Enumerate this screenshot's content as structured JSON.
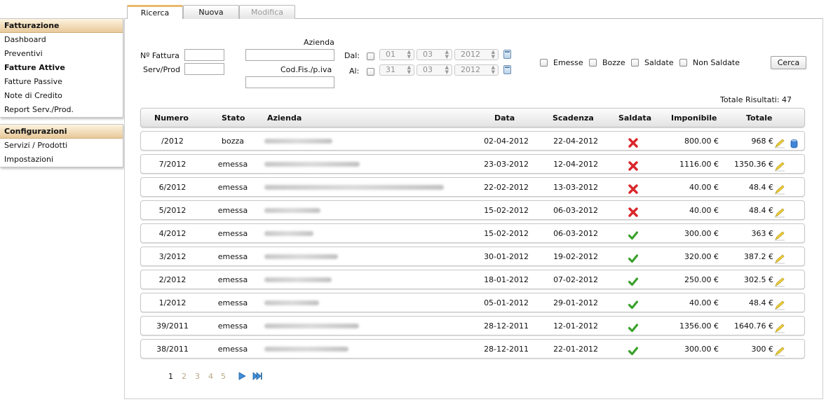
{
  "sidebar": {
    "groups": [
      {
        "title": "Fatturazione",
        "items": [
          "Dashboard",
          "Preventivi",
          "Fatture Attive",
          "Fatture Passive",
          "Note di Credito",
          "Report Serv./Prod."
        ]
      },
      {
        "title": "Configurazioni",
        "items": [
          "Servizi / Prodotti",
          "Impostazioni"
        ]
      }
    ],
    "active_item": "Fatture Attive"
  },
  "tabs": [
    {
      "label": "Ricerca",
      "state": "selected"
    },
    {
      "label": "Nuova",
      "state": "normal"
    },
    {
      "label": "Modifica",
      "state": "disabled"
    }
  ],
  "search": {
    "numero_label": "Nº Fattura",
    "numero_value": "",
    "servprod_label": "Serv/Prod",
    "servprod_value": "",
    "azienda_label": "Azienda",
    "azienda_value": "",
    "codfis_label": "Cod.Fis./p.iva",
    "codfis_value": "",
    "dal_label": "Dal:",
    "al_label": "Al:",
    "dal": {
      "day": "01",
      "month": "03",
      "year": "2012"
    },
    "al": {
      "day": "31",
      "month": "03",
      "year": "2012"
    },
    "filters": [
      "Emesse",
      "Bozze",
      "Saldate",
      "Non Saldate"
    ],
    "button": "Cerca"
  },
  "total_results": "Totale Risultati: 47",
  "table": {
    "headers": [
      "Numero",
      "Stato",
      "Azienda",
      "Data",
      "Scadenza",
      "Saldata",
      "Imponibile",
      "Totale"
    ],
    "rows": [
      {
        "numero": "/2012",
        "stato": "bozza",
        "data": "02-04-2012",
        "scadenza": "22-04-2012",
        "saldata": false,
        "imponibile": "800.00 €",
        "totale": "968 €",
        "deletable": true
      },
      {
        "numero": "7/2012",
        "stato": "emessa",
        "data": "23-03-2012",
        "scadenza": "12-04-2012",
        "saldata": false,
        "imponibile": "1116.00 €",
        "totale": "1350.36 €",
        "deletable": false
      },
      {
        "numero": "6/2012",
        "stato": "emessa",
        "data": "22-02-2012",
        "scadenza": "13-03-2012",
        "saldata": false,
        "imponibile": "40.00 €",
        "totale": "48.4 €",
        "deletable": false
      },
      {
        "numero": "5/2012",
        "stato": "emessa",
        "data": "15-02-2012",
        "scadenza": "06-03-2012",
        "saldata": false,
        "imponibile": "40.00 €",
        "totale": "48.4 €",
        "deletable": false
      },
      {
        "numero": "4/2012",
        "stato": "emessa",
        "data": "15-02-2012",
        "scadenza": "06-03-2012",
        "saldata": true,
        "imponibile": "300.00 €",
        "totale": "363 €",
        "deletable": false
      },
      {
        "numero": "3/2012",
        "stato": "emessa",
        "data": "30-01-2012",
        "scadenza": "19-02-2012",
        "saldata": true,
        "imponibile": "320.00 €",
        "totale": "387.2 €",
        "deletable": false
      },
      {
        "numero": "2/2012",
        "stato": "emessa",
        "data": "18-01-2012",
        "scadenza": "07-02-2012",
        "saldata": true,
        "imponibile": "250.00 €",
        "totale": "302.5 €",
        "deletable": false
      },
      {
        "numero": "1/2012",
        "stato": "emessa",
        "data": "05-01-2012",
        "scadenza": "29-01-2012",
        "saldata": true,
        "imponibile": "40.00 €",
        "totale": "48.4 €",
        "deletable": false
      },
      {
        "numero": "39/2011",
        "stato": "emessa",
        "data": "28-12-2011",
        "scadenza": "12-01-2012",
        "saldata": true,
        "imponibile": "1356.00 €",
        "totale": "1640.76 €",
        "deletable": false
      },
      {
        "numero": "38/2011",
        "stato": "emessa",
        "data": "28-12-2011",
        "scadenza": "22-01-2012",
        "saldata": true,
        "imponibile": "300.00 €",
        "totale": "300 €",
        "deletable": false
      }
    ]
  },
  "pagination": {
    "pages": [
      "1",
      "2",
      "3",
      "4",
      "5"
    ],
    "current": "1"
  },
  "colors": {
    "accent": "#e8b96c",
    "paid": "#3aa12c",
    "unpaid": "#d9262b",
    "link": "#b9a786"
  }
}
